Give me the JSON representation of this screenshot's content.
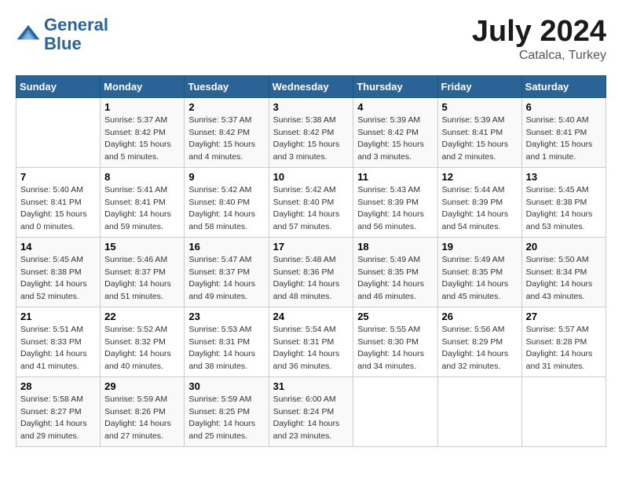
{
  "header": {
    "logo_line1": "General",
    "logo_line2": "Blue",
    "month": "July 2024",
    "location": "Catalca, Turkey"
  },
  "weekdays": [
    "Sunday",
    "Monday",
    "Tuesday",
    "Wednesday",
    "Thursday",
    "Friday",
    "Saturday"
  ],
  "weeks": [
    [
      {
        "day": "",
        "info": ""
      },
      {
        "day": "1",
        "info": "Sunrise: 5:37 AM\nSunset: 8:42 PM\nDaylight: 15 hours\nand 5 minutes."
      },
      {
        "day": "2",
        "info": "Sunrise: 5:37 AM\nSunset: 8:42 PM\nDaylight: 15 hours\nand 4 minutes."
      },
      {
        "day": "3",
        "info": "Sunrise: 5:38 AM\nSunset: 8:42 PM\nDaylight: 15 hours\nand 3 minutes."
      },
      {
        "day": "4",
        "info": "Sunrise: 5:39 AM\nSunset: 8:42 PM\nDaylight: 15 hours\nand 3 minutes."
      },
      {
        "day": "5",
        "info": "Sunrise: 5:39 AM\nSunset: 8:41 PM\nDaylight: 15 hours\nand 2 minutes."
      },
      {
        "day": "6",
        "info": "Sunrise: 5:40 AM\nSunset: 8:41 PM\nDaylight: 15 hours\nand 1 minute."
      }
    ],
    [
      {
        "day": "7",
        "info": "Sunrise: 5:40 AM\nSunset: 8:41 PM\nDaylight: 15 hours\nand 0 minutes."
      },
      {
        "day": "8",
        "info": "Sunrise: 5:41 AM\nSunset: 8:41 PM\nDaylight: 14 hours\nand 59 minutes."
      },
      {
        "day": "9",
        "info": "Sunrise: 5:42 AM\nSunset: 8:40 PM\nDaylight: 14 hours\nand 58 minutes."
      },
      {
        "day": "10",
        "info": "Sunrise: 5:42 AM\nSunset: 8:40 PM\nDaylight: 14 hours\nand 57 minutes."
      },
      {
        "day": "11",
        "info": "Sunrise: 5:43 AM\nSunset: 8:39 PM\nDaylight: 14 hours\nand 56 minutes."
      },
      {
        "day": "12",
        "info": "Sunrise: 5:44 AM\nSunset: 8:39 PM\nDaylight: 14 hours\nand 54 minutes."
      },
      {
        "day": "13",
        "info": "Sunrise: 5:45 AM\nSunset: 8:38 PM\nDaylight: 14 hours\nand 53 minutes."
      }
    ],
    [
      {
        "day": "14",
        "info": "Sunrise: 5:45 AM\nSunset: 8:38 PM\nDaylight: 14 hours\nand 52 minutes."
      },
      {
        "day": "15",
        "info": "Sunrise: 5:46 AM\nSunset: 8:37 PM\nDaylight: 14 hours\nand 51 minutes."
      },
      {
        "day": "16",
        "info": "Sunrise: 5:47 AM\nSunset: 8:37 PM\nDaylight: 14 hours\nand 49 minutes."
      },
      {
        "day": "17",
        "info": "Sunrise: 5:48 AM\nSunset: 8:36 PM\nDaylight: 14 hours\nand 48 minutes."
      },
      {
        "day": "18",
        "info": "Sunrise: 5:49 AM\nSunset: 8:35 PM\nDaylight: 14 hours\nand 46 minutes."
      },
      {
        "day": "19",
        "info": "Sunrise: 5:49 AM\nSunset: 8:35 PM\nDaylight: 14 hours\nand 45 minutes."
      },
      {
        "day": "20",
        "info": "Sunrise: 5:50 AM\nSunset: 8:34 PM\nDaylight: 14 hours\nand 43 minutes."
      }
    ],
    [
      {
        "day": "21",
        "info": "Sunrise: 5:51 AM\nSunset: 8:33 PM\nDaylight: 14 hours\nand 41 minutes."
      },
      {
        "day": "22",
        "info": "Sunrise: 5:52 AM\nSunset: 8:32 PM\nDaylight: 14 hours\nand 40 minutes."
      },
      {
        "day": "23",
        "info": "Sunrise: 5:53 AM\nSunset: 8:31 PM\nDaylight: 14 hours\nand 38 minutes."
      },
      {
        "day": "24",
        "info": "Sunrise: 5:54 AM\nSunset: 8:31 PM\nDaylight: 14 hours\nand 36 minutes."
      },
      {
        "day": "25",
        "info": "Sunrise: 5:55 AM\nSunset: 8:30 PM\nDaylight: 14 hours\nand 34 minutes."
      },
      {
        "day": "26",
        "info": "Sunrise: 5:56 AM\nSunset: 8:29 PM\nDaylight: 14 hours\nand 32 minutes."
      },
      {
        "day": "27",
        "info": "Sunrise: 5:57 AM\nSunset: 8:28 PM\nDaylight: 14 hours\nand 31 minutes."
      }
    ],
    [
      {
        "day": "28",
        "info": "Sunrise: 5:58 AM\nSunset: 8:27 PM\nDaylight: 14 hours\nand 29 minutes."
      },
      {
        "day": "29",
        "info": "Sunrise: 5:59 AM\nSunset: 8:26 PM\nDaylight: 14 hours\nand 27 minutes."
      },
      {
        "day": "30",
        "info": "Sunrise: 5:59 AM\nSunset: 8:25 PM\nDaylight: 14 hours\nand 25 minutes."
      },
      {
        "day": "31",
        "info": "Sunrise: 6:00 AM\nSunset: 8:24 PM\nDaylight: 14 hours\nand 23 minutes."
      },
      {
        "day": "",
        "info": ""
      },
      {
        "day": "",
        "info": ""
      },
      {
        "day": "",
        "info": ""
      }
    ]
  ]
}
